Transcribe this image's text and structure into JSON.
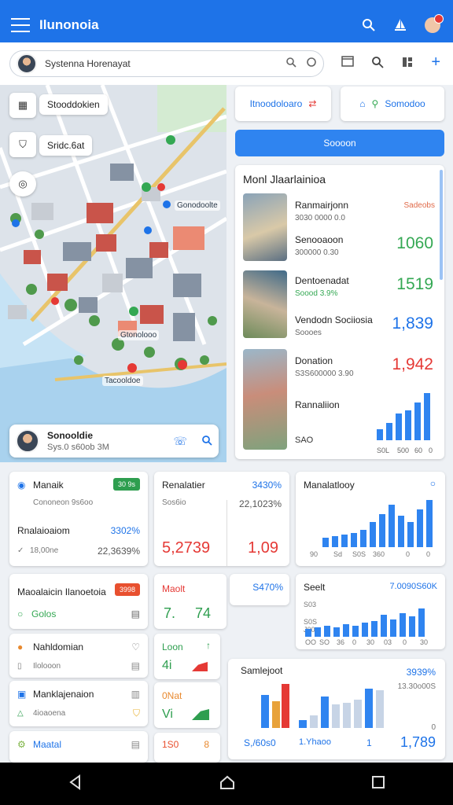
{
  "appbar": {
    "title": "Ilunonoia",
    "actions": [
      "search-icon",
      "sailboat-icon",
      "notification-avatar"
    ]
  },
  "search": {
    "value": "Systenna Horenayat"
  },
  "map": {
    "layer_button": "Stooddokien",
    "route_button": "Sridc.6at",
    "streets": [
      "Gonodoolte",
      "Gtonolooo",
      "Tacooldoe"
    ],
    "profile": {
      "name": "Sonooldie",
      "sub": "Sys.0 s60ob 3M"
    }
  },
  "right": {
    "btn_left": "Itnoodoloaro",
    "btn_right": "Somodoo",
    "primary": "Soooon",
    "list_title": "Monl Jlaarlainioa",
    "items": [
      {
        "name": "Ranmairjonn",
        "sub": "3030 0000 0.0",
        "tag": "Sadeobs",
        "value": ""
      },
      {
        "name": "Senooaoon",
        "sub": "300000 0.30",
        "value": "1060"
      },
      {
        "name": "Dentoenadat",
        "sub": "Soood 3.9%",
        "value": "1519"
      },
      {
        "name": "Vendodn Sociiosia",
        "sub": "Soooes",
        "value": "1,839"
      },
      {
        "name": "Donation",
        "sub": "S3S600000 3.90",
        "value": "1,942"
      },
      {
        "name": "Rannaliion",
        "sub": "SAO",
        "value": ""
      }
    ],
    "mini_chart_ticks": [
      "S0L",
      "500",
      "60",
      "0"
    ]
  },
  "cards": {
    "c1": {
      "title": "Manaik",
      "badge": "30 9s",
      "sub": "Cononeon 9s6oo",
      "title2": "Rnalaioaiom",
      "val2": "3302%",
      "sub2": "18,00ne",
      "val3": "22,3639%"
    },
    "c2": {
      "title": "Renalatier",
      "val": "3430%",
      "sub": "Sos6io",
      "val2": "22,1023%",
      "big1": "5,2739",
      "big2": "1,09"
    },
    "c3": {
      "title": "Manalatlooy",
      "ticks": [
        "90",
        "Sd",
        "S0S",
        "360",
        "0",
        "0"
      ]
    },
    "c4": {
      "title": "Maoalaicin Ilanoetoia",
      "badge": "3998",
      "item": "Golos"
    },
    "c5": {
      "title": "Maolt",
      "val": "S470%",
      "big1": "7.",
      "big2": "74"
    },
    "c6": {
      "title": "Seelt",
      "val": "7.0090S60K",
      "ticks": [
        "S03",
        "S0S",
        "J00"
      ],
      "xticks": [
        "OO",
        "SO",
        "36",
        "0",
        "30",
        "03",
        "0",
        "30"
      ]
    },
    "c7": {
      "title": "Nahldomian",
      "sub": "Ilolooon"
    },
    "c8": {
      "title": "Manklajenaion",
      "sub": "4ioaoena"
    },
    "c9": {
      "title": "Maatal"
    },
    "c10": {
      "a": "Loon",
      "a_val": "4i",
      "b": "0Nat",
      "b_val": "Vi"
    },
    "c11": {
      "title": "Samlejoot",
      "bottom": "S,/60s0"
    },
    "c12": {
      "val": "3939%",
      "sub": "13.30o00S",
      "tick": "0",
      "val2": "1,789",
      "bottom": "1.Yhaoo",
      "num": "1"
    },
    "c13": {
      "val": "1S0",
      "val2": "8"
    }
  }
}
